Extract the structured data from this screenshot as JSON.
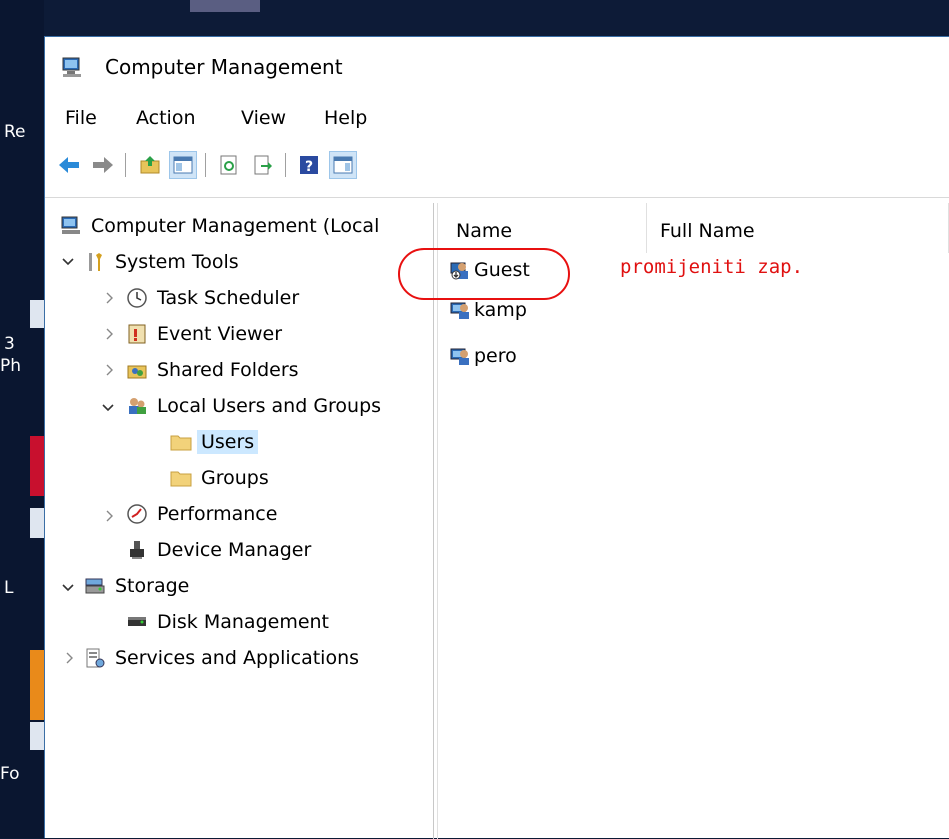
{
  "window": {
    "title": "Computer Management"
  },
  "menu": [
    "File",
    "Action",
    "View",
    "Help"
  ],
  "toolbar": [
    {
      "icon": "back-arrow-icon"
    },
    {
      "icon": "forward-arrow-icon"
    },
    {
      "icon": "up-folder-icon"
    },
    {
      "icon": "show-hide-tree-icon",
      "active": true
    },
    {
      "icon": "refresh-icon"
    },
    {
      "icon": "export-list-icon"
    },
    {
      "icon": "help-icon"
    },
    {
      "icon": "action-pane-icon",
      "active": true
    }
  ],
  "tree": {
    "root": "Computer Management (Local",
    "system_tools": "System Tools",
    "task_scheduler": "Task Scheduler",
    "event_viewer": "Event Viewer",
    "shared_folders": "Shared Folders",
    "local_users_groups": "Local Users and Groups",
    "users": "Users",
    "groups": "Groups",
    "performance": "Performance",
    "device_manager": "Device Manager",
    "storage": "Storage",
    "disk_management": "Disk Management",
    "services_apps": "Services and Applications"
  },
  "list": {
    "columns": [
      "Name",
      "Full Name"
    ],
    "rows": [
      {
        "name": "Guest",
        "full_name": ""
      },
      {
        "name": "kamp",
        "full_name": ""
      },
      {
        "name": "pero",
        "full_name": ""
      }
    ]
  },
  "annotation": {
    "text": "promijeniti zap.",
    "color": "#e01010"
  },
  "desktop": {
    "fragments": [
      "Re",
      "3",
      "Ph",
      "L",
      "Fo"
    ]
  }
}
